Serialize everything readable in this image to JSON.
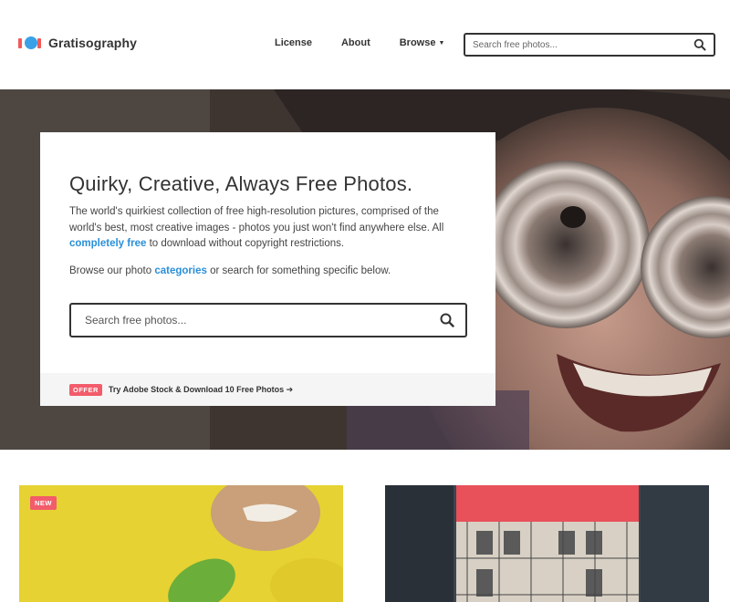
{
  "brand": {
    "name": "Gratisography",
    "colors": {
      "accent": "#2a8fd8",
      "badge": "#f25c6b",
      "text": "#333333"
    }
  },
  "nav": {
    "license": "License",
    "about": "About",
    "browse": "Browse"
  },
  "header_search": {
    "placeholder": "Search free photos...",
    "icon": "search-icon"
  },
  "hero": {
    "title": "Quirky, Creative, Always Free Photos.",
    "desc_main": "The world's quirkiest collection of free high-resolution pictures, comprised of the world's best, most creative images - photos you just won't find anywhere else. All",
    "desc_link": "completely free",
    "desc_tail": "to download without copyright restrictions.",
    "browse_prefix": "Browse our photo",
    "browse_link": "categories",
    "browse_suffix": "or search for something specific below.",
    "search_placeholder": "Search free photos...",
    "offer_badge": "OFFER",
    "offer_text": "Try Adobe Stock & Download 10 Free Photos"
  },
  "photos": [
    {
      "badge": "NEW"
    },
    {
      "badge": ""
    }
  ]
}
